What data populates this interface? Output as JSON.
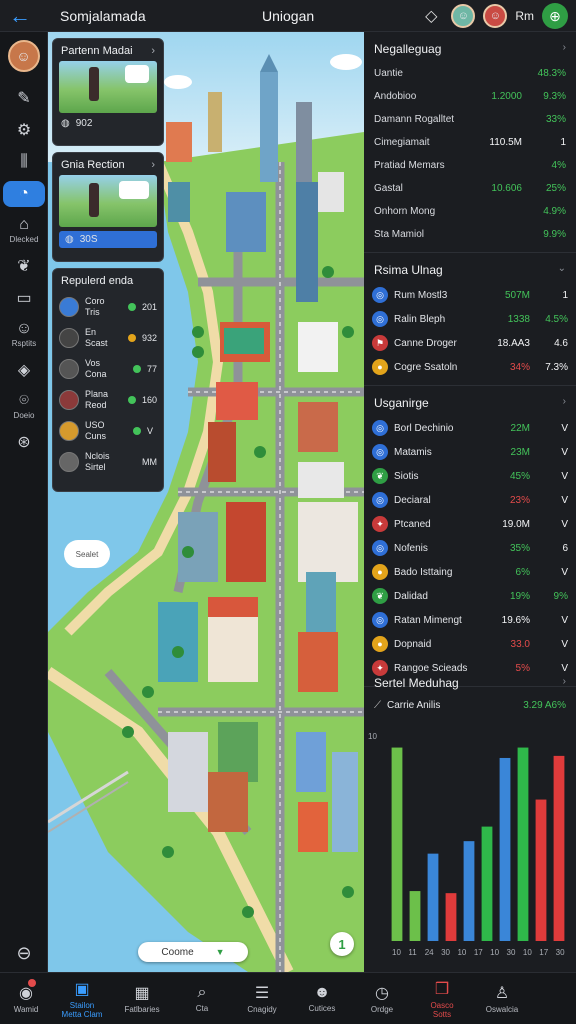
{
  "topbar": {
    "back_icon": "back-arrow-icon",
    "title": "Somjalamada",
    "center": "Uniogan",
    "right_label": "Rm",
    "icons": [
      "tag-icon",
      "avatar",
      "avatar",
      "add-icon"
    ]
  },
  "sidebar": {
    "items": [
      {
        "icon": "pen-icon",
        "glyph": "✎",
        "label": ""
      },
      {
        "icon": "gear-icon",
        "glyph": "⚙",
        "label": ""
      },
      {
        "icon": "bars-icon",
        "glyph": "⫼",
        "label": ""
      },
      {
        "icon": "chat-icon",
        "glyph": "◔",
        "label": "",
        "active": true
      },
      {
        "icon": "building-icon",
        "glyph": "⌂",
        "label": "Dlecked"
      },
      {
        "icon": "leaf-icon",
        "glyph": "❦",
        "label": ""
      },
      {
        "icon": "frame-icon",
        "glyph": "▭",
        "label": ""
      },
      {
        "icon": "people-icon",
        "glyph": "☺",
        "label": "Rsptits"
      },
      {
        "icon": "drop-icon",
        "glyph": "◈",
        "label": ""
      },
      {
        "icon": "map-icon",
        "glyph": "⌾",
        "label": "Doeio"
      },
      {
        "icon": "compass-icon",
        "glyph": "⊛",
        "label": ""
      }
    ],
    "bottom_icon": "minus-circle-icon"
  },
  "map": {
    "card1": {
      "title": "Partenn Madai",
      "footer": "902"
    },
    "card2": {
      "title": "Gnia Rection",
      "footer": "30S"
    },
    "players": {
      "title": "Repulerd enda",
      "rows": [
        {
          "name1": "Coro",
          "name2": "Tris",
          "value": "201",
          "dot": "green",
          "av": "#3a7bd5"
        },
        {
          "name1": "En",
          "name2": "Scast",
          "value": "932",
          "dot": "orange",
          "av": "#444"
        },
        {
          "name1": "Vos",
          "name2": "Cona",
          "value": "77",
          "dot": "green",
          "av": "#555"
        },
        {
          "name1": "Plana",
          "name2": "Reod",
          "value": "160",
          "dot": "green",
          "av": "#8b3a3a"
        },
        {
          "name1": "USO",
          "name2": "Cuns",
          "value": "V",
          "dot": "green",
          "av": "#d69a2d"
        },
        {
          "name1": "Nclois",
          "name2": "Sirtel",
          "value": "MM",
          "dot": "none",
          "av": "#666"
        }
      ]
    },
    "cloud_label": "Sealet",
    "search_label": "Coome",
    "badge": "1"
  },
  "panel": {
    "section1": {
      "title": "Negalleguag",
      "rows": [
        {
          "k": "Uantie",
          "v1": "",
          "v2": "48.3%",
          "c1": "green",
          "c2": "green"
        },
        {
          "k": "Andobioo",
          "v1": "1.2000",
          "v2": "9.3%",
          "c1": "green",
          "c2": "green"
        },
        {
          "k": "Damann Rogalltet",
          "v1": "",
          "v2": "33%",
          "c1": "green",
          "c2": "green"
        },
        {
          "k": "Cimegiamait",
          "v1": "110.5M",
          "v2": "1",
          "c1": "white",
          "c2": "white"
        },
        {
          "k": "Pratiad Memars",
          "v1": "",
          "v2": "4%",
          "c1": "green",
          "c2": "green"
        },
        {
          "k": "Gastal",
          "v1": "10.606",
          "v2": "25%",
          "c1": "green",
          "c2": "green"
        },
        {
          "k": "Onhorn Mong",
          "v1": "",
          "v2": "4.9%",
          "c1": "green",
          "c2": "green"
        },
        {
          "k": "Sta Mamiol",
          "v1": "",
          "v2": "9.9%",
          "c1": "green",
          "c2": "green"
        }
      ]
    },
    "section2": {
      "title": "Rsima Ulnag",
      "rows": [
        {
          "k": "Rum Mostl3",
          "v1": "507M",
          "v2": "1",
          "c1": "green",
          "c2": "white",
          "dot": "#2f6fd6",
          "icon": "globe-icon",
          "g": "◎"
        },
        {
          "k": "Ralin Bleph",
          "v1": "1338",
          "v2": "4.5%",
          "c1": "green",
          "c2": "green",
          "dot": "#2f6fd6",
          "icon": "globe-icon",
          "g": "◎"
        },
        {
          "k": "Canne Droger",
          "v1": "18.AA3",
          "v2": "4.6",
          "c1": "white",
          "c2": "white",
          "dot": "#c83a3a",
          "icon": "flag-icon",
          "g": "⚑"
        },
        {
          "k": "Cogre Ssatoln",
          "v1": "34%",
          "v2": "7.3%",
          "c1": "red",
          "c2": "white",
          "dot": "#e3a41b",
          "icon": "coin-icon",
          "g": "●"
        }
      ]
    },
    "section3": {
      "title": "Usganirge",
      "rows": [
        {
          "k": "Borl Dechinio",
          "v1": "22M",
          "v2": "V",
          "c1": "green",
          "c2": "white",
          "dot": "#2f6fd6",
          "icon": "globe-icon",
          "g": "◎"
        },
        {
          "k": "Matamis",
          "v1": "23M",
          "v2": "V",
          "c1": "green",
          "c2": "white",
          "dot": "#2f6fd6",
          "icon": "globe-icon",
          "g": "◎"
        },
        {
          "k": "Siotis",
          "v1": "45%",
          "v2": "V",
          "c1": "green",
          "c2": "white",
          "dot": "#2f9e44",
          "icon": "leaf-icon",
          "g": "❦"
        },
        {
          "k": "Deciaral",
          "v1": "23%",
          "v2": "V",
          "c1": "red",
          "c2": "white",
          "dot": "#2f6fd6",
          "icon": "globe-icon",
          "g": "◎"
        },
        {
          "k": "Ptcaned",
          "v1": "19.0M",
          "v2": "V",
          "c1": "white",
          "c2": "white",
          "dot": "#c83a3a",
          "icon": "fire-icon",
          "g": "✦"
        },
        {
          "k": "Nofenis",
          "v1": "35%",
          "v2": "6",
          "c1": "green",
          "c2": "white",
          "dot": "#2f6fd6",
          "icon": "globe-icon",
          "g": "◎"
        },
        {
          "k": "Bado Isttaing",
          "v1": "6%",
          "v2": "V",
          "c1": "green",
          "c2": "white",
          "dot": "#e3a41b",
          "icon": "coin-icon",
          "g": "●"
        },
        {
          "k": "Dalidad",
          "v1": "19%",
          "v2": "9%",
          "c1": "green",
          "c2": "green",
          "dot": "#2f9e44",
          "icon": "leaf-icon",
          "g": "❦"
        },
        {
          "k": "Ratan Mimengt",
          "v1": "19.6%",
          "v2": "V",
          "c1": "white",
          "c2": "white",
          "dot": "#2f6fd6",
          "icon": "globe-icon",
          "g": "◎"
        },
        {
          "k": "Dopnaid",
          "v1": "33.0",
          "v2": "V",
          "c1": "red",
          "c2": "white",
          "dot": "#e3a41b",
          "icon": "coin-icon",
          "g": "●"
        },
        {
          "k": "Rangoe Scieads",
          "v1": "5%",
          "v2": "V",
          "c1": "red",
          "c2": "white",
          "dot": "#c83a3a",
          "icon": "fire-icon",
          "g": "✦"
        }
      ]
    },
    "chart_section": {
      "title": "Sertel Meduhag",
      "legend": "Carrie Anilis",
      "legend_value": "3.29 A6%"
    }
  },
  "chart_data": {
    "type": "bar",
    "title": "Sertel Meduhag",
    "categories": [
      "10",
      "11",
      "24",
      "30",
      "10",
      "17",
      "10",
      "30",
      "10",
      "17",
      "30"
    ],
    "values": [
      93,
      24,
      42,
      23,
      48,
      55,
      88,
      93,
      68,
      89
    ],
    "colors": [
      "#6cc04a",
      "#6cc04a",
      "#3a86d8",
      "#e03b3b",
      "#3a86d8",
      "#2fb84a",
      "#3a86d8",
      "#2fb84a",
      "#e03b3b",
      "#e03b3b"
    ],
    "y_tick": "10",
    "ylim": [
      0,
      100
    ],
    "grid": false
  },
  "bottomnav": {
    "items": [
      {
        "icon": "alert-icon",
        "glyph": "◉",
        "label": "Wamid",
        "badge": true
      },
      {
        "icon": "bulletin-icon",
        "glyph": "▣",
        "label": "Stailon\nMetta Clam",
        "active": true
      },
      {
        "icon": "calendar-icon",
        "glyph": "▦",
        "label": "Fatlbaries"
      },
      {
        "icon": "search-icon",
        "glyph": "⌕",
        "label": "Cta"
      },
      {
        "icon": "list-icon",
        "glyph": "☰",
        "label": "Cnagidy"
      },
      {
        "icon": "people-icon",
        "glyph": "☻",
        "label": "Cutices"
      },
      {
        "icon": "clock-icon",
        "glyph": "◷",
        "label": "Ordge"
      },
      {
        "icon": "gift-icon",
        "glyph": "❒",
        "label": "Oasco\nSotts",
        "alert": true
      },
      {
        "icon": "person-icon",
        "glyph": "♙",
        "label": "Oswalcia"
      }
    ]
  }
}
